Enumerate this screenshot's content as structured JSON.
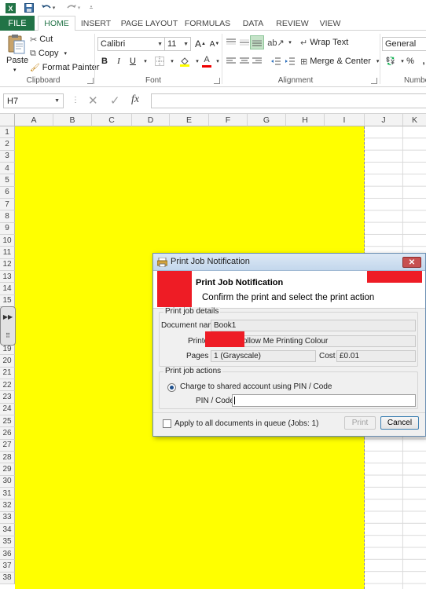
{
  "excel": {
    "quick_access": {
      "save_icon": "save-icon",
      "undo_icon": "undo-icon",
      "redo_icon": "redo-icon",
      "customize_icon": "customize-qat-icon"
    },
    "tabs": [
      {
        "label": "FILE"
      },
      {
        "label": "HOME"
      },
      {
        "label": "INSERT"
      },
      {
        "label": "PAGE LAYOUT"
      },
      {
        "label": "FORMULAS"
      },
      {
        "label": "DATA"
      },
      {
        "label": "REVIEW"
      },
      {
        "label": "VIEW"
      }
    ],
    "ribbon": {
      "clipboard": {
        "paste": "Paste",
        "cut": "Cut",
        "copy": "Copy",
        "format_painter": "Format Painter",
        "group_label": "Clipboard"
      },
      "font": {
        "font_name": "Calibri",
        "font_size": "11",
        "bold": "B",
        "italic": "I",
        "underline": "U",
        "grow": "A",
        "shrink": "A",
        "font_color": "A",
        "group_label": "Font"
      },
      "alignment": {
        "wrap_text": "Wrap Text",
        "merge_center": "Merge & Center",
        "group_label": "Alignment"
      },
      "number": {
        "format": "General",
        "percent": "%",
        "comma": ",",
        "group_label": "Numbe"
      }
    },
    "formula_bar": {
      "name_box": "H7",
      "fx": "fx",
      "cancel": "✕",
      "enter": "✓",
      "value": ""
    },
    "columns": [
      "A",
      "B",
      "C",
      "D",
      "E",
      "F",
      "G",
      "H",
      "I",
      "J",
      "K"
    ],
    "rows": [
      "1",
      "2",
      "3",
      "4",
      "5",
      "6",
      "7",
      "8",
      "9",
      "10",
      "11",
      "12",
      "13",
      "14",
      "15",
      "",
      "",
      "",
      "19",
      "20",
      "21",
      "22",
      "23",
      "24",
      "25",
      "26",
      "27",
      "28",
      "29",
      "30",
      "31",
      "32",
      "33",
      "34",
      "35",
      "36",
      "37",
      "38"
    ],
    "fill_color": "#ffff00"
  },
  "dialog": {
    "title": "Print Job Notification",
    "header_title": "Print Job Notification",
    "header_subtitle": "Confirm the print and select the print action",
    "details": {
      "legend": "Print job details",
      "document_label": "Document name",
      "document_value": "Book1",
      "printer_label": "Printe",
      "printer_value": "ollow Me Printing Colour",
      "pages_label": "Pages",
      "pages_value": "1  (Grayscale)",
      "cost_label": "Cost",
      "cost_value": "£0.01"
    },
    "actions": {
      "legend": "Print job actions",
      "charge_option": "Charge to shared account using PIN / Code",
      "pin_label": "PIN / Code",
      "pin_value": ""
    },
    "apply_all": "Apply to all documents in queue (Jobs: 1)",
    "print_button": "Print",
    "cancel_button": "Cancel",
    "redaction_color": "#ee1c25"
  }
}
